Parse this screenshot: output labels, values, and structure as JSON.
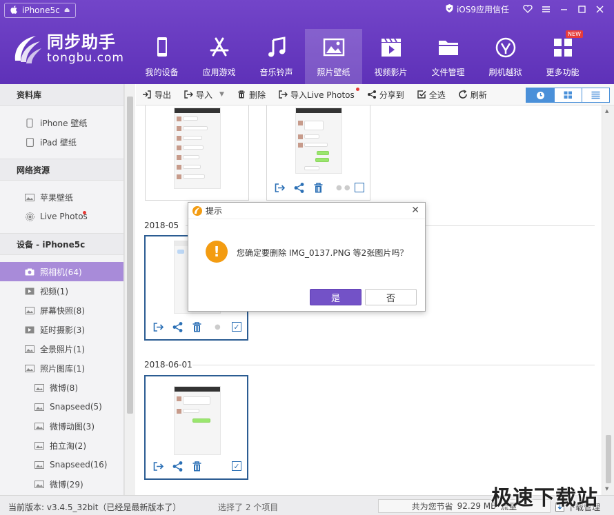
{
  "window": {
    "device_tab": "iPhone5c",
    "trust_label": "iOS9应用信任"
  },
  "brand": {
    "cn": "同步助手",
    "en": "tongbu.com"
  },
  "nav": {
    "items": [
      {
        "label": "我的设备",
        "icon": "phone-icon"
      },
      {
        "label": "应用游戏",
        "icon": "app-store-icon"
      },
      {
        "label": "音乐铃声",
        "icon": "music-icon"
      },
      {
        "label": "照片壁纸",
        "icon": "picture-icon"
      },
      {
        "label": "视频影片",
        "icon": "video-icon"
      },
      {
        "label": "文件管理",
        "icon": "folder-icon"
      },
      {
        "label": "刷机越狱",
        "icon": "jailbreak-icon"
      },
      {
        "label": "更多功能",
        "icon": "more-icon"
      }
    ],
    "new_badge": "NEW"
  },
  "sidebar": {
    "sections": [
      {
        "title": "资料库",
        "items": [
          {
            "label": "iPhone 壁纸"
          },
          {
            "label": "iPad 壁纸"
          }
        ]
      },
      {
        "title": "网络资源",
        "items": [
          {
            "label": "苹果壁纸"
          },
          {
            "label": "Live Photos"
          }
        ]
      },
      {
        "title": "设备 - iPhone5c",
        "items": [
          {
            "label": "照相机(64)"
          },
          {
            "label": "视频(1)"
          },
          {
            "label": "屏幕快照(8)"
          },
          {
            "label": "延时摄影(3)"
          },
          {
            "label": "全景照片(1)"
          },
          {
            "label": "照片图库(1)"
          },
          {
            "label": "微博(8)"
          },
          {
            "label": "Snapseed(5)"
          },
          {
            "label": "微博动图(3)"
          },
          {
            "label": "拍立淘(2)"
          },
          {
            "label": "Snapseed(16)"
          },
          {
            "label": "微博(29)"
          }
        ]
      }
    ]
  },
  "toolbar": {
    "export": "导出",
    "import": "导入",
    "delete": "删除",
    "import_live": "导入Live Photos",
    "share": "分享到",
    "select_all": "全选",
    "refresh": "刷新"
  },
  "content": {
    "groups": [
      {
        "date": "2018-05"
      },
      {
        "date": "2018-06-01"
      }
    ]
  },
  "dialog": {
    "title": "提示",
    "message": "您确定要删除 IMG_0137.PNG 等2张图片吗？",
    "yes": "是",
    "no": "否"
  },
  "status": {
    "version": "当前版本: v3.4.5_32bit（已经是最新版本了）",
    "selection": "选择了 2 个项目",
    "saved_prefix": "共为您节省",
    "saved_value": "92.29 MB",
    "saved_suffix": "流量",
    "download": "下载管理"
  },
  "watermark": "极速下载站",
  "colors": {
    "header": "#6a3cc2",
    "accent": "#7352c7",
    "selected_item": "#a88bd9",
    "action_blue": "#2a6fb5"
  }
}
